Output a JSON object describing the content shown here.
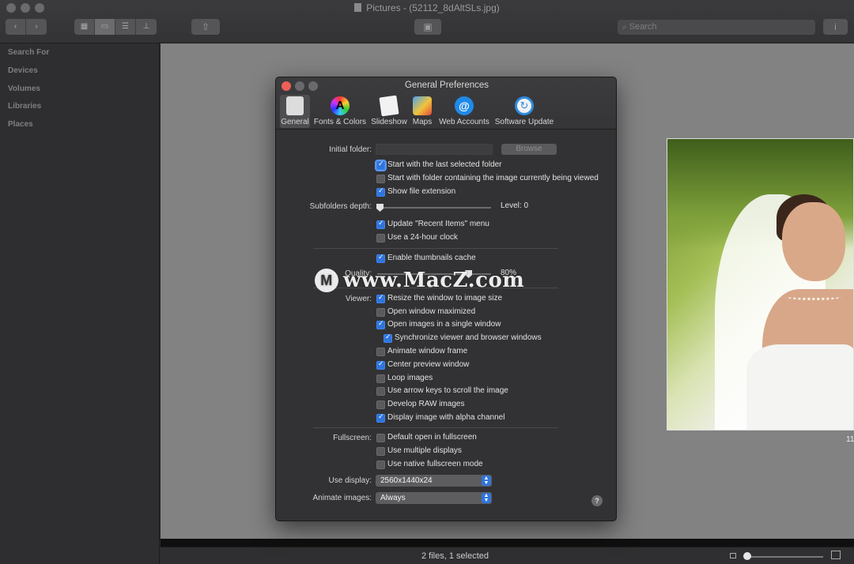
{
  "window": {
    "title": "Pictures - (52112_8dAltSLs.jpg)",
    "search_placeholder": "Search"
  },
  "sidebar": {
    "sections": [
      "Search For",
      "Devices",
      "Volumes",
      "Libraries",
      "Places"
    ]
  },
  "status": {
    "text": "2 files, 1 selected",
    "side_number": "11"
  },
  "dialog": {
    "title": "General Preferences",
    "tabs": [
      {
        "label": "General",
        "icon": "general-switch-icon"
      },
      {
        "label": "Fonts & Colors",
        "icon": "color-wheel-icon"
      },
      {
        "label": "Slideshow",
        "icon": "slideshow-icon"
      },
      {
        "label": "Maps",
        "icon": "maps-icon"
      },
      {
        "label": "Web Accounts",
        "icon": "at-sign-icon"
      },
      {
        "label": "Software Update",
        "icon": "refresh-icon"
      }
    ],
    "initial_folder_label": "Initial folder:",
    "browse_label": "Browse",
    "options": {
      "start_last": {
        "label": "Start with the last selected folder",
        "checked": true
      },
      "start_viewed": {
        "label": "Start with folder containing the image currently being viewed",
        "checked": false
      },
      "show_ext": {
        "label": "Show file extension",
        "checked": true
      },
      "update_recent": {
        "label": "Update \"Recent Items\" menu",
        "checked": true
      },
      "clock24": {
        "label": "Use a 24-hour clock",
        "checked": false
      },
      "thumb_cache": {
        "label": "Enable thumbnails cache",
        "checked": true
      },
      "resize": {
        "label": "Resize the window to image size",
        "checked": true
      },
      "maximized": {
        "label": "Open window maximized",
        "checked": false
      },
      "single_window": {
        "label": "Open images in a single window",
        "checked": true
      },
      "sync": {
        "label": "Synchronize viewer and browser windows",
        "checked": true
      },
      "animate_frame": {
        "label": "Animate window frame",
        "checked": false
      },
      "center_preview": {
        "label": "Center preview window",
        "checked": true
      },
      "loop": {
        "label": "Loop images",
        "checked": false
      },
      "arrow_keys": {
        "label": "Use arrow keys to scroll the image",
        "checked": false
      },
      "raw": {
        "label": "Develop RAW images",
        "checked": false
      },
      "alpha": {
        "label": "Display image with alpha channel",
        "checked": true
      },
      "fs_default": {
        "label": "Default open in fullscreen",
        "checked": false
      },
      "fs_multi": {
        "label": "Use multiple displays",
        "checked": false
      },
      "fs_native": {
        "label": "Use native fullscreen mode",
        "checked": false
      }
    },
    "subfolders_label": "Subfolders depth:",
    "subfolders_level_text": "Level: 0",
    "subfolders_level_value": 0,
    "quality_label": "Quality:",
    "quality_text": "80%",
    "quality_value": 0.8,
    "viewer_label": "Viewer:",
    "fullscreen_label": "Fullscreen:",
    "use_display_label": "Use display:",
    "use_display_value": "2560x1440x24",
    "animate_images_label": "Animate images:",
    "animate_images_value": "Always",
    "help_label": "?"
  },
  "watermark": {
    "text": "www.MacZ.com"
  },
  "colors": {
    "accent": "#2f75de",
    "close": "#ed5f57",
    "minimize": "#6a6a6c",
    "zoom": "#6a6a6c"
  }
}
